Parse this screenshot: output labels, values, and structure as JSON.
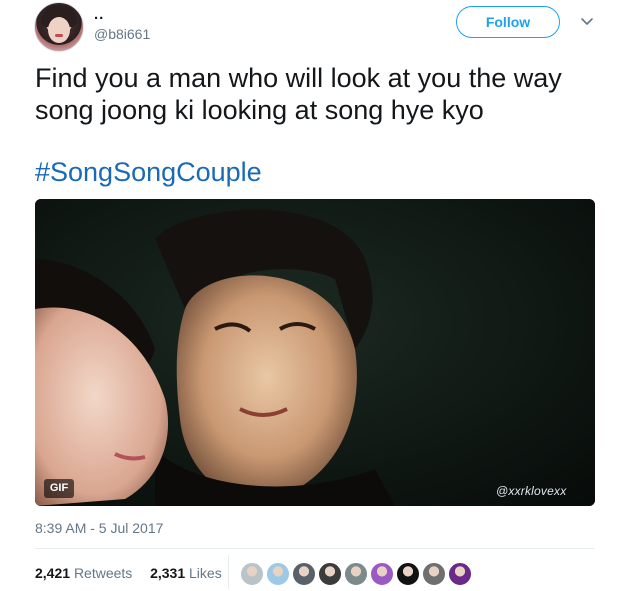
{
  "tweet": {
    "display_name": "..",
    "screen_name": "@b8i661",
    "follow_label": "Follow",
    "text_line1": "Find you a man who will look at you the way",
    "text_line2": "song joong ki looking at song hye kyo",
    "hashtag": "#SongSongCouple",
    "media": {
      "badge": "GIF",
      "watermark": "@xxrklovexx"
    },
    "timestamp": "8:39 AM - 5 Jul 2017",
    "stats": {
      "retweets_count": "2,421",
      "retweets_label": "Retweets",
      "likes_count": "2,331",
      "likes_label": "Likes"
    },
    "likers": [
      {
        "icon": "liker-avatar-1",
        "color": "#b9c4c9"
      },
      {
        "icon": "liker-avatar-2",
        "color": "#9cc9e6"
      },
      {
        "icon": "liker-avatar-3",
        "color": "#58606a"
      },
      {
        "icon": "liker-avatar-4",
        "color": "#3b3b3b"
      },
      {
        "icon": "liker-avatar-5",
        "color": "#7b8a8b"
      },
      {
        "icon": "liker-avatar-6",
        "color": "#9b59c4"
      },
      {
        "icon": "liker-avatar-7",
        "color": "#111111"
      },
      {
        "icon": "liker-avatar-8",
        "color": "#6f6f6f"
      },
      {
        "icon": "liker-avatar-9",
        "color": "#6a2a8a"
      }
    ]
  },
  "colors": {
    "link": "#1da1f2",
    "hashtag": "#1b6ab5",
    "muted": "#657786"
  }
}
